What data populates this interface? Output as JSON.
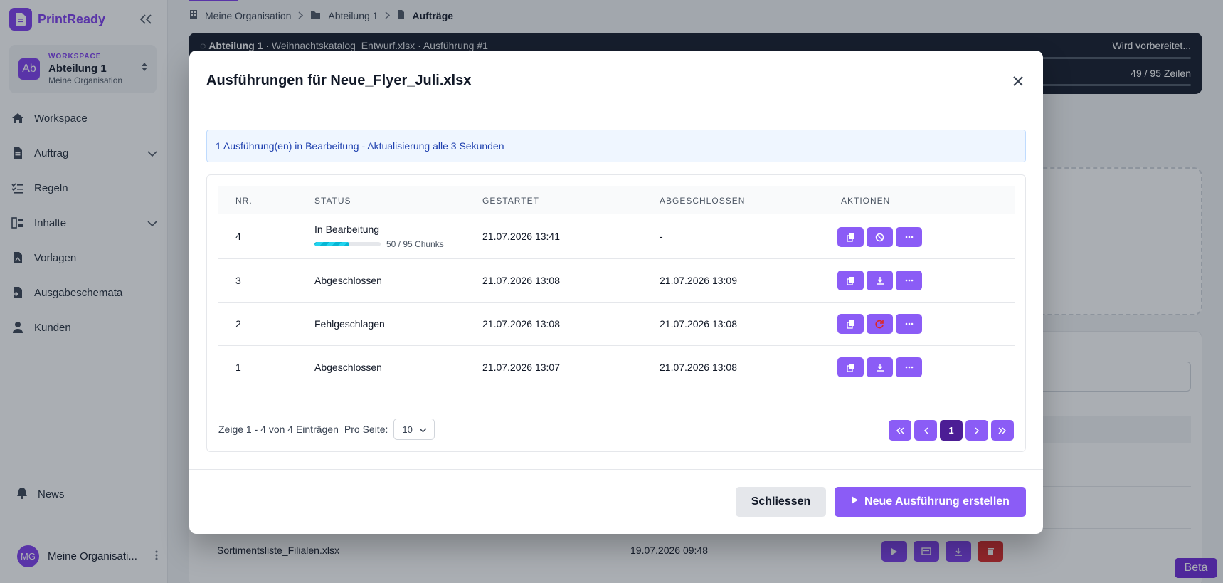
{
  "app": {
    "name": "PrintReady"
  },
  "workspace": {
    "eyebrow": "WORKSPACE",
    "name": "Abteilung 1",
    "org": "Meine Organisation",
    "avatar": "Ab"
  },
  "sidebar": {
    "items": [
      {
        "label": "Workspace",
        "icon": "home-icon"
      },
      {
        "label": "Auftrag",
        "icon": "document-icon",
        "expandable": true
      },
      {
        "label": "Regeln",
        "icon": "rules-icon"
      },
      {
        "label": "Inhalte",
        "icon": "content-icon",
        "expandable": true
      },
      {
        "label": "Vorlagen",
        "icon": "template-icon"
      },
      {
        "label": "Ausgabeschemata",
        "icon": "export-icon"
      },
      {
        "label": "Kunden",
        "icon": "user-icon"
      }
    ],
    "news": "News",
    "user": {
      "initials": "MG",
      "name": "Meine Organisati..."
    }
  },
  "breadcrumb": {
    "items": [
      "Meine Organisation",
      "Abteilung 1",
      "Aufträge"
    ]
  },
  "job_banner": {
    "title_bold": "Abteilung 1",
    "title_rest": " · Weihnachtskatalog_Entwurf.xlsx · Ausführung #1",
    "state": "Wird vorbereitet...",
    "rows": "49 / 95 Zeilen"
  },
  "background_table": {
    "row": {
      "name": "Sortimentsliste_Filialen.xlsx",
      "date": "19.07.2026 09:48"
    }
  },
  "beta_badge": "Beta",
  "modal": {
    "title": "Ausführungen für Neue_Flyer_Juli.xlsx",
    "info": "1 Ausführung(en) in Bearbeitung - Aktualisierung alle 3 Sekunden",
    "columns": [
      "NR.",
      "STATUS",
      "GESTARTET",
      "ABGESCHLOSSEN",
      "AKTIONEN"
    ],
    "rows": [
      {
        "nr": "4",
        "status": "In Bearbeitung",
        "progress": 0.5263,
        "chunks": "50 / 95 Chunks",
        "started": "21.07.2026 13:41",
        "finished": "-"
      },
      {
        "nr": "3",
        "status": "Abgeschlossen",
        "started": "21.07.2026 13:08",
        "finished": "21.07.2026 13:09"
      },
      {
        "nr": "2",
        "status": "Fehlgeschlagen",
        "started": "21.07.2026 13:08",
        "finished": "21.07.2026 13:08"
      },
      {
        "nr": "1",
        "status": "Abgeschlossen",
        "started": "21.07.2026 13:07",
        "finished": "21.07.2026 13:08"
      }
    ],
    "footer": {
      "summary": "Zeige 1 - 4 von 4 Einträgen",
      "per_page_label": "Pro Seite:",
      "per_page_value": "10",
      "current_page": "1"
    },
    "buttons": {
      "close": "Schliessen",
      "new": "Neue Ausführung erstellen"
    }
  }
}
